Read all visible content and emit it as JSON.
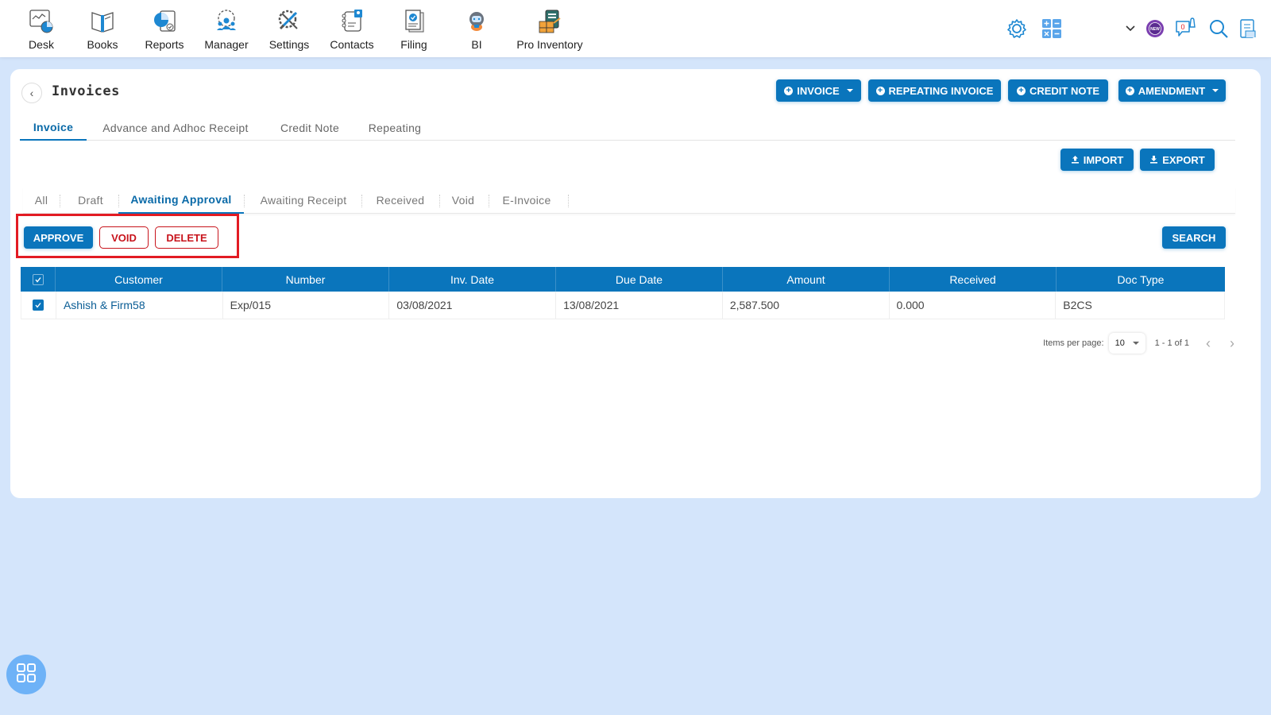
{
  "topnav": {
    "items": [
      {
        "label": "Desk",
        "icon": "desk-icon"
      },
      {
        "label": "Books",
        "icon": "books-icon"
      },
      {
        "label": "Reports",
        "icon": "reports-icon"
      },
      {
        "label": "Manager",
        "icon": "manager-icon"
      },
      {
        "label": "Settings",
        "icon": "settings-tools-icon"
      },
      {
        "label": "Contacts",
        "icon": "contacts-icon"
      },
      {
        "label": "Filing",
        "icon": "filing-icon"
      },
      {
        "label": "BI",
        "icon": "bi-robot-icon"
      },
      {
        "label": "Pro Inventory",
        "icon": "pro-inventory-icon"
      }
    ],
    "right_icons": [
      "gear-icon",
      "calculator-icon",
      "chevron-down-icon",
      "new-badge-icon",
      "notification-icon",
      "search-icon",
      "document-icon"
    ],
    "notification_count": "0",
    "new_badge_text": "NEW"
  },
  "page": {
    "title": "Invoices",
    "back_icon": "chevron-left-icon"
  },
  "actions": {
    "invoice": "INVOICE",
    "repeating_invoice": "REPEATING INVOICE",
    "credit_note": "CREDIT NOTE",
    "amendment": "AMENDMENT",
    "import": "IMPORT",
    "export": "EXPORT",
    "search": "SEARCH"
  },
  "primary_tabs": [
    {
      "label": "Invoice",
      "active": true
    },
    {
      "label": "Advance and Adhoc Receipt",
      "active": false
    },
    {
      "label": "Credit Note",
      "active": false
    },
    {
      "label": "Repeating",
      "active": false
    }
  ],
  "status_tabs": [
    {
      "label": "All",
      "active": false
    },
    {
      "label": "Draft",
      "active": false
    },
    {
      "label": "Awaiting Approval",
      "active": true
    },
    {
      "label": "Awaiting Receipt",
      "active": false
    },
    {
      "label": "Received",
      "active": false
    },
    {
      "label": "Void",
      "active": false
    },
    {
      "label": "E-Invoice",
      "active": false
    }
  ],
  "bulk_actions": {
    "approve": "APPROVE",
    "void": "VOID",
    "delete": "DELETE"
  },
  "table": {
    "columns": [
      "Customer",
      "Number",
      "Inv. Date",
      "Due Date",
      "Amount",
      "Received",
      "Doc Type"
    ],
    "header_checked": true,
    "rows": [
      {
        "checked": true,
        "customer": "Ashish & Firm58",
        "number": "Exp/015",
        "inv_date": "03/08/2021",
        "due_date": "13/08/2021",
        "amount": "2,587.500",
        "received": "0.000",
        "doc_type": "B2CS"
      }
    ]
  },
  "paginator": {
    "items_per_page_label": "Items per page:",
    "items_per_page": "10",
    "range": "1 - 1 of 1"
  },
  "colors": {
    "primary": "#0a75bc",
    "danger": "#c8141c",
    "highlight": "#e21b23",
    "background": "#d4e5fb"
  }
}
